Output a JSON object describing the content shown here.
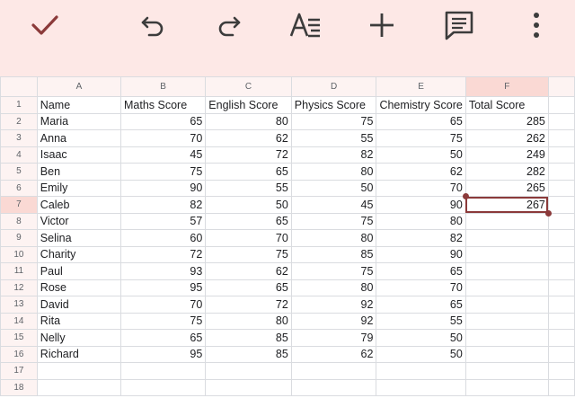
{
  "toolbar": {
    "accent": "#8b3a3a",
    "icon_color": "#3c3c3c",
    "buttons": [
      {
        "name": "done-check-icon"
      },
      {
        "name": "undo-icon"
      },
      {
        "name": "redo-icon"
      },
      {
        "name": "text-format-icon"
      },
      {
        "name": "insert-plus-icon"
      },
      {
        "name": "comment-icon"
      },
      {
        "name": "more-vert-icon"
      }
    ]
  },
  "sheet": {
    "columns": [
      "A",
      "B",
      "C",
      "D",
      "E",
      "F"
    ],
    "selected_cell": "F7",
    "rows": [
      [
        "Name",
        "Maths Score",
        "English Score",
        "Physics Score",
        "Chemistry Score",
        "Total Score"
      ],
      [
        "Maria",
        "65",
        "80",
        "75",
        "65",
        "285"
      ],
      [
        "Anna",
        "70",
        "62",
        "55",
        "75",
        "262"
      ],
      [
        "Isaac",
        "45",
        "72",
        "82",
        "50",
        "249"
      ],
      [
        "Ben",
        "75",
        "65",
        "80",
        "62",
        "282"
      ],
      [
        "Emily",
        "90",
        "55",
        "50",
        "70",
        "265"
      ],
      [
        "Caleb",
        "82",
        "50",
        "45",
        "90",
        "267"
      ],
      [
        "Victor",
        "57",
        "65",
        "75",
        "80",
        ""
      ],
      [
        "Selina",
        "60",
        "70",
        "80",
        "82",
        ""
      ],
      [
        "Charity",
        "72",
        "75",
        "85",
        "90",
        ""
      ],
      [
        "Paul",
        "93",
        "62",
        "75",
        "65",
        ""
      ],
      [
        "Rose",
        "95",
        "65",
        "80",
        "70",
        ""
      ],
      [
        "David",
        "70",
        "72",
        "92",
        "65",
        ""
      ],
      [
        "Rita",
        "75",
        "80",
        "92",
        "55",
        ""
      ],
      [
        "Nelly",
        "65",
        "85",
        "79",
        "50",
        ""
      ],
      [
        "Richard",
        "95",
        "85",
        "62",
        "50",
        ""
      ],
      [
        "",
        "",
        "",
        "",
        "",
        ""
      ],
      [
        "",
        "",
        "",
        "",
        "",
        ""
      ]
    ]
  }
}
